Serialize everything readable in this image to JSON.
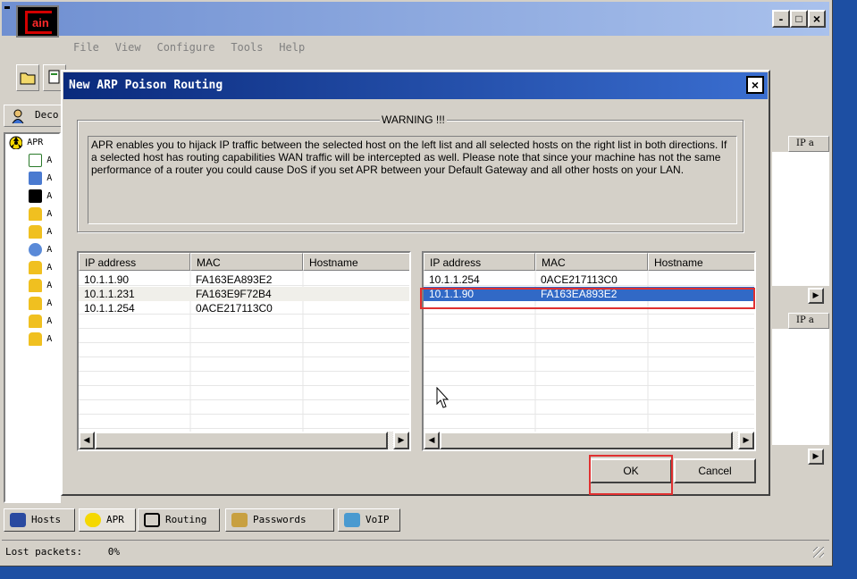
{
  "main_window": {
    "menu": [
      "File",
      "View",
      "Configure",
      "Tools",
      "Help"
    ],
    "logo_text": "ain",
    "decoders_tab": "Deco",
    "tree": {
      "root": "APR",
      "items": [
        "A",
        "A",
        "A",
        "A",
        "A",
        "A",
        "A",
        "A",
        "A",
        "A",
        "A"
      ]
    },
    "right_headers": [
      "IP a",
      "IP a"
    ],
    "bottom_tabs": [
      "Hosts",
      "APR",
      "Routing",
      "Passwords",
      "VoIP"
    ],
    "status": {
      "label": "Lost packets:",
      "value": "0%"
    },
    "window_buttons": {
      "minimize": "-",
      "maximize": "□",
      "close": "×"
    }
  },
  "dialog": {
    "title": "New ARP Poison Routing",
    "close_label": "×",
    "warning_title": "WARNING !!!",
    "warning_text": "APR enables you to hijack IP traffic between the selected host on the left list and all selected hosts on the right list in both directions. If a selected host has routing capabilities WAN traffic will be intercepted as well. Please note that since your machine has not the same performance of a router you could cause DoS if you set APR between your Default Gateway and all other hosts on your LAN.",
    "columns": [
      "IP address",
      "MAC",
      "Hostname"
    ],
    "left_list": [
      {
        "ip": "10.1.1.90",
        "mac": "FA163EA893E2",
        "hostname": ""
      },
      {
        "ip": "10.1.1.231",
        "mac": "FA163E9F72B4",
        "hostname": ""
      },
      {
        "ip": "10.1.1.254",
        "mac": "0ACE217113C0",
        "hostname": ""
      }
    ],
    "right_list": [
      {
        "ip": "10.1.1.254",
        "mac": "0ACE217113C0",
        "hostname": ""
      },
      {
        "ip": "10.1.1.90",
        "mac": "FA163EA893E2",
        "hostname": "",
        "selected": true
      }
    ],
    "ok_label": "OK",
    "cancel_label": "Cancel"
  },
  "colors": {
    "selection": "#3169c6",
    "highlight": "#e03030",
    "dialog_title": "#0a2a7c"
  }
}
